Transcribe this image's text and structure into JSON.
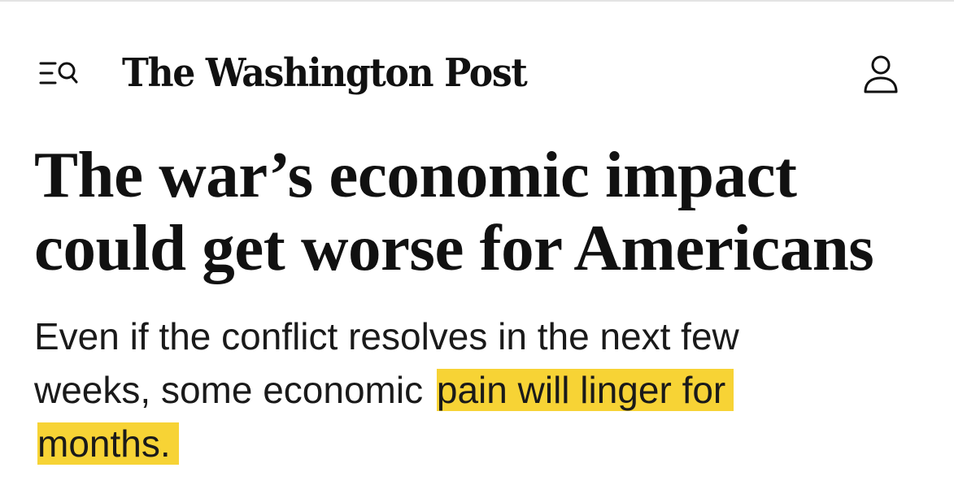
{
  "masthead": {
    "logo_text": "The Washington Post",
    "menu_icon": "menu-search-icon",
    "account_icon": "user-icon"
  },
  "article": {
    "headline": "The war’s economic impact could get worse for Americans",
    "dek_plain": "Even if the conflict resolves in the next few weeks, some economic",
    "dek_highlight": "pain will linger for months."
  },
  "colors": {
    "highlight": "#f7d335",
    "text": "#111111",
    "background": "#ffffff"
  }
}
